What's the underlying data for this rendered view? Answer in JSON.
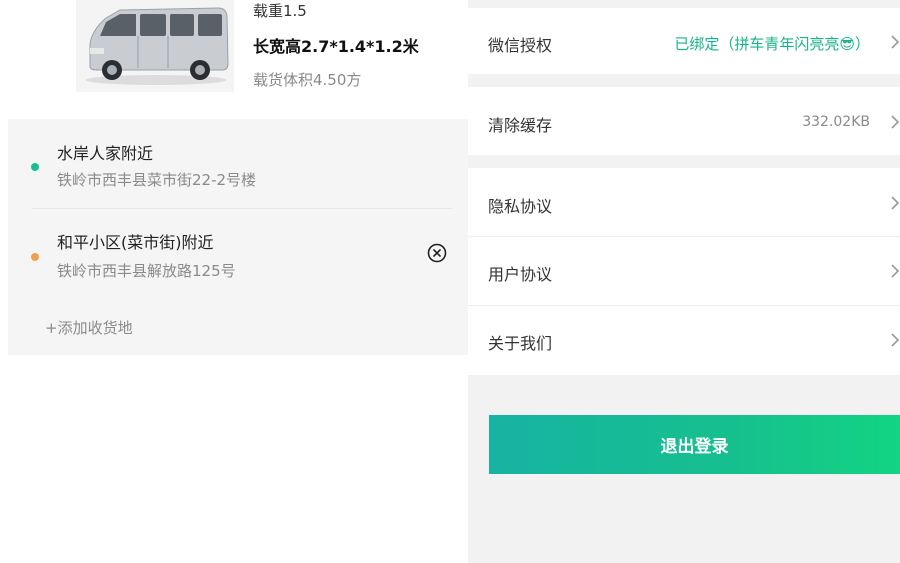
{
  "vehicle": {
    "load": "载重1.5",
    "dimensions": "长宽高2.7*1.4*1.2米",
    "volume": "载货体积4.50方"
  },
  "addresses": [
    {
      "title": "水岸人家附近",
      "detail": "铁岭市西丰县菜市街22-2号楼",
      "dot_color": "#18c08f"
    },
    {
      "title": "和平小区(菜市街)附近",
      "detail": "铁岭市西丰县解放路125号",
      "dot_color": "#f0a050"
    }
  ],
  "add_address_label": "+添加收货地",
  "settings": {
    "wechat": {
      "label": "微信授权",
      "value": "已绑定（拼车青年闪亮亮😎）"
    },
    "cache": {
      "label": "清除缓存",
      "value": "332.02KB"
    },
    "privacy": {
      "label": "隐私协议"
    },
    "user_agreement": {
      "label": "用户协议"
    },
    "about": {
      "label": "关于我们"
    }
  },
  "logout_label": "退出登录",
  "colors": {
    "accent": "#16c08d",
    "link_green": "#18b58c"
  }
}
